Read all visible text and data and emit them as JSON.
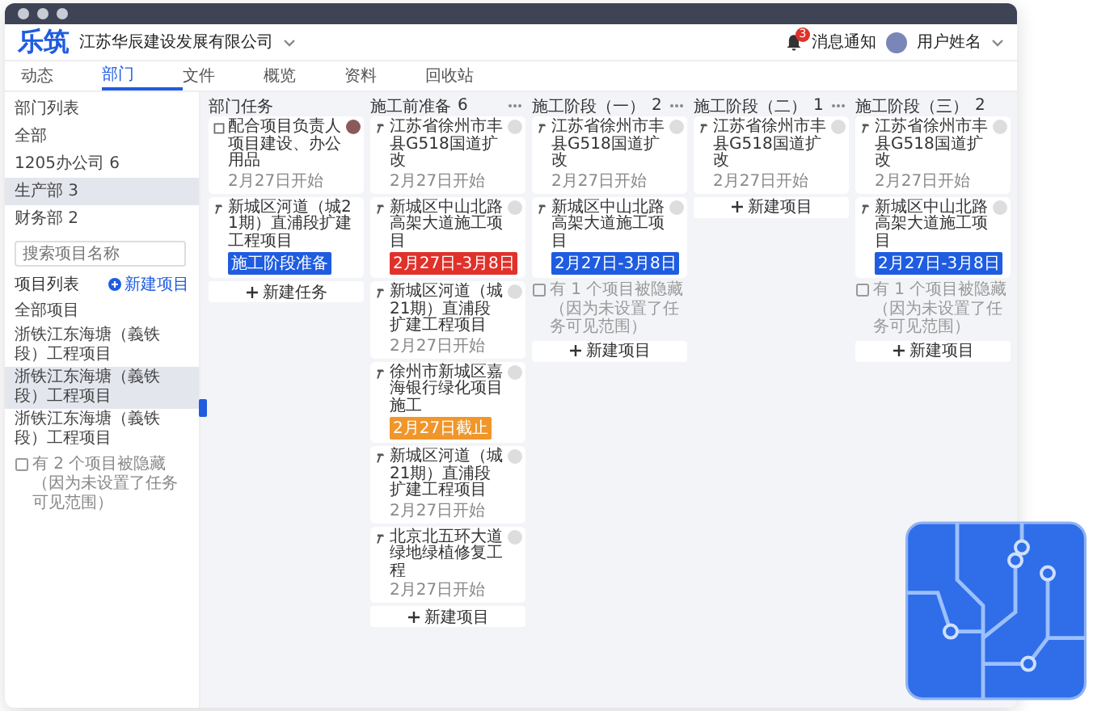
{
  "header": {
    "logo": "乐筑",
    "company": "江苏华辰建设发展有限公司",
    "notification_count": "3",
    "notification_label": "消息通知",
    "user_name": "用户姓名"
  },
  "tabs": [
    {
      "label": "动态",
      "selected": false
    },
    {
      "label": "部门",
      "selected": true
    },
    {
      "label": "文件",
      "selected": false
    },
    {
      "label": "概览",
      "selected": false
    },
    {
      "label": "资料",
      "selected": false
    },
    {
      "label": "回收站",
      "selected": false
    }
  ],
  "sidebar": {
    "dept_heading": "部门列表",
    "departments": [
      {
        "label": "全部",
        "selected": false
      },
      {
        "label": "1205办公司 6",
        "selected": false
      },
      {
        "label": "生产部 3",
        "selected": true
      },
      {
        "label": "财务部 2",
        "selected": false
      }
    ],
    "search": {
      "placeholder": "搜索项目名称"
    },
    "project_heading": "项目列表",
    "new_project": "新建项目",
    "projects": [
      {
        "label": "全部项目",
        "selected": false
      },
      {
        "label": "浙铁江东海塘（義铁段）工程项目",
        "selected": false
      },
      {
        "label": "浙铁江东海塘（義铁段）工程项目",
        "selected": true
      },
      {
        "label": "浙铁江东海塘（義铁段）工程项目",
        "selected": false
      }
    ],
    "hidden_note": "有 2 个项目被隐藏（因为未设置了任务可见范围）"
  },
  "board": [
    {
      "title": "部门任务",
      "menu": false,
      "cards": [
        {
          "kind": "task",
          "title": "配合项目负责人项目建设、办公用品",
          "date": "2月27日开始",
          "avatar_photo": true
        },
        {
          "kind": "project",
          "title": "新城区河道（城21期）直浦段扩建工程项目",
          "tag": {
            "text": "施工阶段准备",
            "color": "#1f5ce0"
          }
        }
      ],
      "add": "新建任务"
    },
    {
      "title": "施工前准备",
      "count": "6",
      "menu": true,
      "cards": [
        {
          "kind": "project",
          "title": "江苏省徐州市丰县G518国道扩改",
          "date": "2月27日开始",
          "avatar_photo": false
        },
        {
          "kind": "project",
          "title": "新城区中山北路高架大道施工项目",
          "tag": {
            "text": "2月27日-3月8日",
            "color": "#e0312b"
          },
          "avatar_photo": false
        },
        {
          "kind": "project",
          "title": "新城区河道（城21期）直浦段扩建工程项目",
          "date": "2月27日开始",
          "avatar_photo": false
        },
        {
          "kind": "project",
          "title": "徐州市新城区嘉海银行绿化项目施工",
          "tag": {
            "text": "2月27日截止",
            "color": "#f0962a"
          },
          "avatar_photo": false
        },
        {
          "kind": "project",
          "title": "新城区河道（城21期）直浦段扩建工程项目",
          "date": "2月27日开始",
          "avatar_photo": false
        },
        {
          "kind": "project",
          "title": "北京北五环大道绿地绿植修复工程",
          "date": "2月27日开始",
          "avatar_photo": false
        }
      ],
      "add": "新建项目"
    },
    {
      "title": "施工阶段（一）",
      "count": "2",
      "menu": true,
      "cards": [
        {
          "kind": "project",
          "title": "江苏省徐州市丰县G518国道扩改",
          "date": "2月27日开始",
          "avatar_photo": false
        },
        {
          "kind": "project",
          "title": "新城区中山北路高架大道施工项目",
          "tag": {
            "text": "2月27日-3月8日",
            "color": "#1f5ce0"
          },
          "avatar_photo": false
        }
      ],
      "note": "有 1 个项目被隐藏（因为未设置了任务可见范围）",
      "add": "新建项目"
    },
    {
      "title": "施工阶段（二）",
      "count": "1",
      "menu": true,
      "cards": [
        {
          "kind": "project",
          "title": "江苏省徐州市丰县G518国道扩改",
          "date": "2月27日开始",
          "avatar_photo": false
        }
      ],
      "add": "新建项目"
    },
    {
      "title": "施工阶段（三）",
      "count": "2",
      "menu": false,
      "cards": [
        {
          "kind": "project",
          "title": "江苏省徐州市丰县G518国道扩改",
          "date": "2月27日开始",
          "avatar_photo": false
        },
        {
          "kind": "project",
          "title": "新城区中山北路高架大道施工项目",
          "tag": {
            "text": "2月27日-3月8日",
            "color": "#1f5ce0"
          },
          "avatar_photo": false
        }
      ],
      "note": "有 1 个项目被隐藏（因为未设置了任务可见范围）",
      "add": "新建项目"
    }
  ]
}
